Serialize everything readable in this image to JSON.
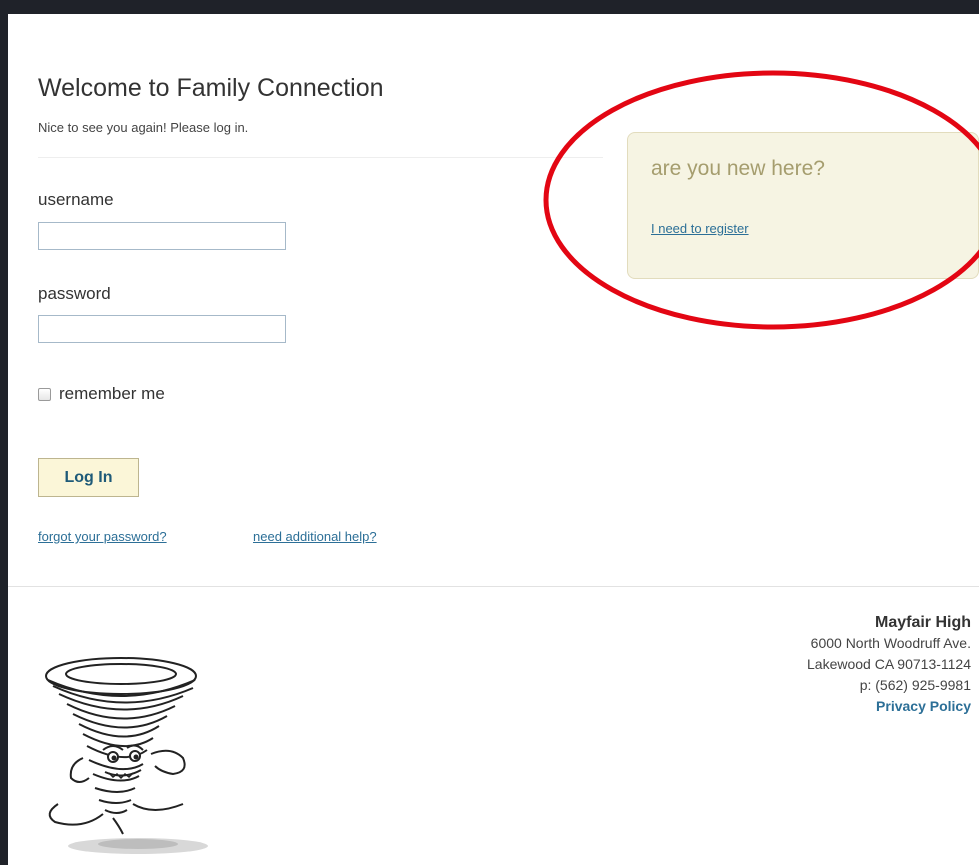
{
  "login": {
    "title": "Welcome to Family Connection",
    "subtitle": "Nice to see you again! Please log in.",
    "username_label": "username",
    "username_value": "",
    "password_label": "password",
    "password_value": "",
    "remember_label": "remember me",
    "remember_checked": false,
    "login_button": "Log In",
    "forgot_link": "forgot your password?",
    "help_link": "need additional help?"
  },
  "register": {
    "heading": "are you new here?",
    "link": "I need to register"
  },
  "footer": {
    "school_name": "Mayfair High",
    "street": "6000 North Woodruff Ave.",
    "city_line": "Lakewood CA 90713-1124",
    "phone": "p: (562) 925-9981",
    "privacy_link": "Privacy Policy"
  },
  "colors": {
    "link": "#2c6f97",
    "button_bg": "#fbf6d8",
    "register_box_bg": "#f6f4e3",
    "register_heading": "#a59d6e",
    "annotation": "#e30613",
    "frame": "#1f2229"
  },
  "icons": {
    "mascot": "tornado-mascot-image"
  }
}
